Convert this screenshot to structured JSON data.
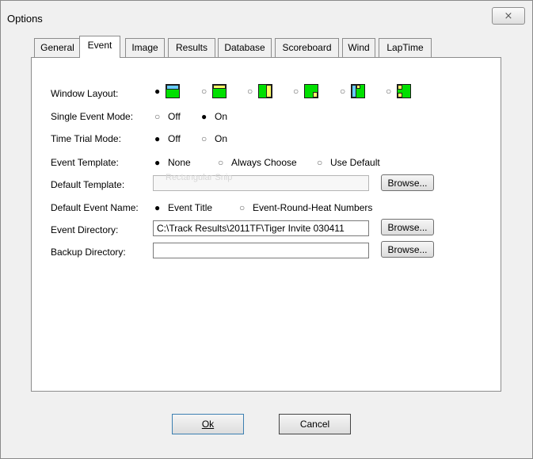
{
  "window": {
    "title": "Options",
    "close_glyph": "⨯"
  },
  "tabs": [
    "General",
    "Event",
    "Image",
    "Results",
    "Database",
    "Scoreboard",
    "Wind",
    "LapTime"
  ],
  "active_tab": "Event",
  "form": {
    "window_layout_label": "Window Layout:",
    "single_event_label": "Single Event Mode:",
    "single_event_off": "Off",
    "single_event_on": "On",
    "time_trial_label": "Time Trial Mode:",
    "time_trial_off": "Off",
    "time_trial_on": "On",
    "event_template_label": "Event Template:",
    "event_template_none": "None",
    "event_template_always": "Always Choose",
    "event_template_default": "Use Default",
    "default_template_label": "Default Template:",
    "default_template_value": "",
    "default_template_ghost": "Rectangular Snip",
    "default_event_name_label": "Default Event Name:",
    "event_title_option": "Event Title",
    "event_round_option": "Event-Round-Heat Numbers",
    "event_directory_label": "Event Directory:",
    "event_directory_value": "C:\\Track Results\\2011TF\\Tiger Invite 030411",
    "backup_directory_label": "Backup Directory:",
    "backup_directory_value": "",
    "browse_label": "Browse..."
  },
  "buttons": {
    "ok": "Ok",
    "cancel": "Cancel"
  },
  "colors": {
    "layout_green": "#00e000",
    "layout_yellow": "#ffff66",
    "layout_cyan": "#66ccff"
  }
}
